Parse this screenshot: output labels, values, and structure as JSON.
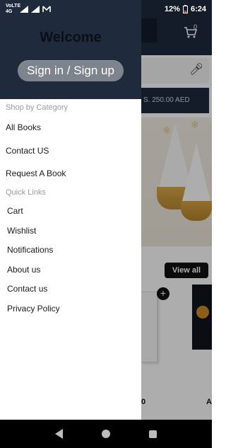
{
  "status_bar": {
    "left_icons": [
      "volte-icon",
      "4g-signal-icon",
      "signal-icon",
      "gmail-icon"
    ],
    "left_text": "VoLTE 4G",
    "battery": "12%",
    "time": "6:24"
  },
  "background": {
    "cart_count": "0",
    "banner_text": "S. 250.00 AED",
    "view_all_label": "View all",
    "price_1": "0",
    "price_2": "A"
  },
  "drawer": {
    "welcome": "Welcome",
    "signin_label": "Sign in / Sign up",
    "shop_by_category_label": "Shop by Category",
    "category_items": [
      "All Books",
      "Contact US",
      "Request A Book"
    ],
    "quick_links_label": "Quick Links",
    "quick_items": [
      "Cart",
      "Wishlist",
      "Notifications",
      "About us",
      "Contact us",
      "Privacy Policy"
    ]
  },
  "colors": {
    "header": "#1f2a3d",
    "signin_button": "#7e848d"
  }
}
